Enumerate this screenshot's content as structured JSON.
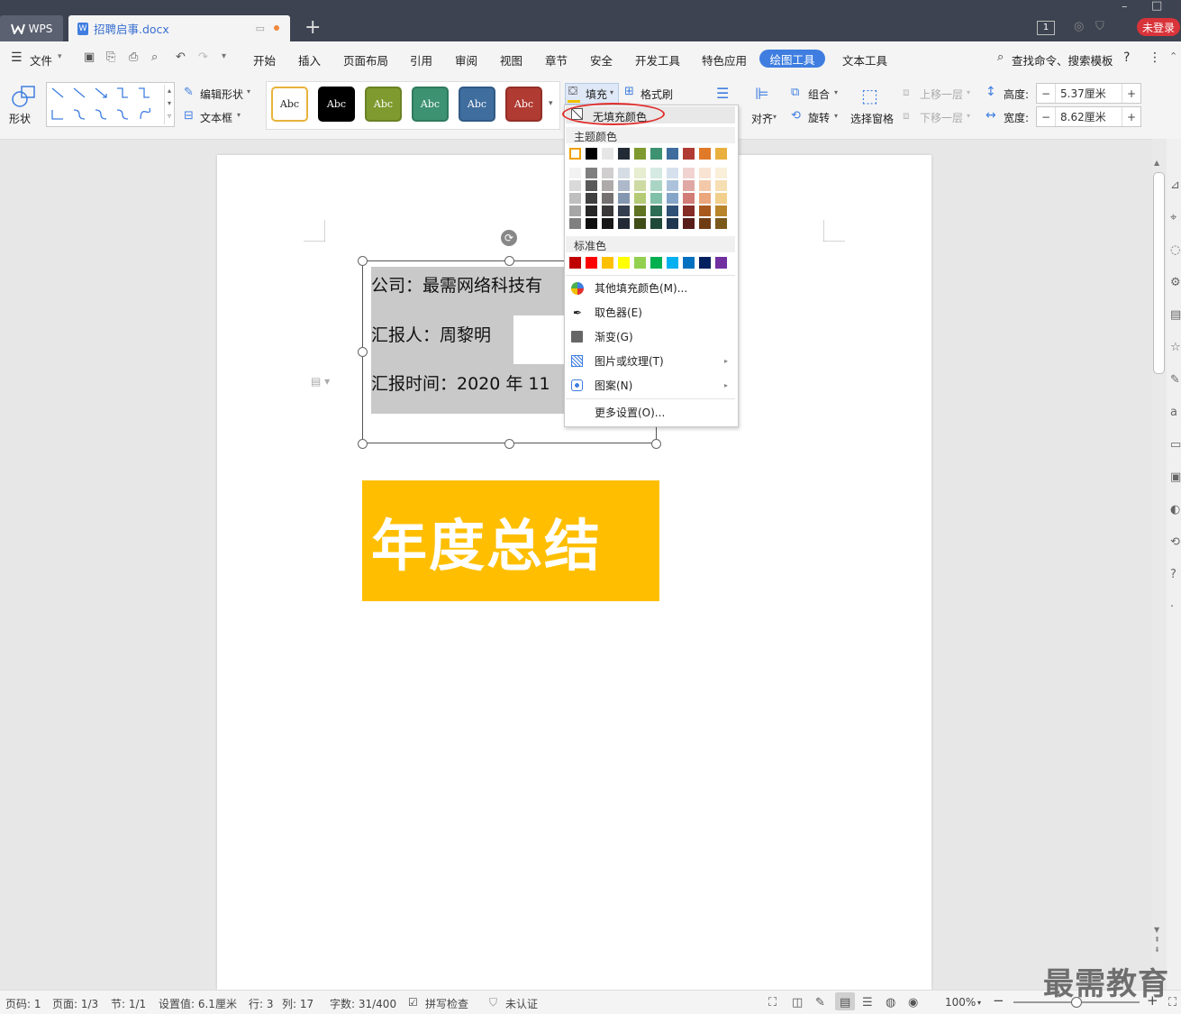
{
  "titlebar": {
    "app_tab": "WPS",
    "doc_tab": "招聘启事.docx",
    "login": "未登录",
    "badge": "1"
  },
  "menu": {
    "file": "文件",
    "items": [
      "开始",
      "插入",
      "页面布局",
      "引用",
      "审阅",
      "视图",
      "章节",
      "安全",
      "开发工具",
      "特色应用"
    ],
    "active": "绘图工具",
    "text_tools": "文本工具",
    "search": "查找命令、搜索模板"
  },
  "ribbon": {
    "shape": "形状",
    "edit_shape": "编辑形状",
    "text_box": "文本框",
    "style_samples": [
      {
        "label": "Abc",
        "bg": "#ffffff",
        "fg": "#222222",
        "border": "#e7b33b"
      },
      {
        "label": "Abc",
        "bg": "#000000",
        "fg": "#ffffff",
        "border": "#000000"
      },
      {
        "label": "Abc",
        "bg": "#7f9a2e",
        "fg": "#ffffff",
        "border": "#6a8224"
      },
      {
        "label": "Abc",
        "bg": "#3d9272",
        "fg": "#ffffff",
        "border": "#2f7a5e"
      },
      {
        "label": "Abc",
        "bg": "#3f6d9e",
        "fg": "#ffffff",
        "border": "#315a86"
      },
      {
        "label": "Abc",
        "bg": "#b03b32",
        "fg": "#ffffff",
        "border": "#932f27"
      }
    ],
    "fill": "填充",
    "format_painter": "格式刷",
    "align": "对齐",
    "group": "组合",
    "rotate": "旋转",
    "selection_pane": "选择窗格",
    "bring_forward": "上移一层",
    "send_backward": "下移一层",
    "height_label": "高度:",
    "height_value": "5.37厘米",
    "width_label": "宽度:",
    "width_value": "8.62厘米"
  },
  "dropdown": {
    "no_fill": "无填充颜色",
    "theme_colors": "主题颜色",
    "theme_row": [
      "#ffffff",
      "#000000",
      "#e7e6e6",
      "#222a35",
      "#7f9a2e",
      "#3d9272",
      "#3f6d9e",
      "#b03b32",
      "#e07a29",
      "#e9b040"
    ],
    "shade_cols": [
      [
        "#f2f2f2",
        "#d9d9d9",
        "#bfbfbf",
        "#a6a6a6",
        "#808080"
      ],
      [
        "#7f7f7f",
        "#595959",
        "#404040",
        "#262626",
        "#0d0d0d"
      ],
      [
        "#d0cece",
        "#aeaaaa",
        "#757171",
        "#3a3838",
        "#181717"
      ],
      [
        "#d6dce4",
        "#adb9ca",
        "#8497b0",
        "#333f4f",
        "#222a35"
      ],
      [
        "#e6edd1",
        "#cddba3",
        "#b4ca76",
        "#5f7322",
        "#3f4d17"
      ],
      [
        "#d5eae2",
        "#aad5c5",
        "#80c0a8",
        "#2e6d55",
        "#1e4939"
      ],
      [
        "#d6e1ed",
        "#adc3db",
        "#85a5c9",
        "#2f5176",
        "#1f364f"
      ],
      [
        "#f0d3d1",
        "#e0a8a4",
        "#d17c76",
        "#842c25",
        "#581d19"
      ],
      [
        "#f9e4d4",
        "#f3c9a9",
        "#eca67d",
        "#a85a1e",
        "#703c14"
      ],
      [
        "#faefd9",
        "#f6dfb3",
        "#f1cf8c",
        "#b9852a",
        "#7b591c"
      ]
    ],
    "standard_colors_label": "标准色",
    "standard_colors": [
      "#c00000",
      "#ff0000",
      "#ffc000",
      "#ffff00",
      "#92d050",
      "#00b050",
      "#00b0f0",
      "#0070c0",
      "#002060",
      "#7030a0"
    ],
    "more_fill": "其他填充颜色(M)...",
    "eyedropper": "取色器(E)",
    "gradient": "渐变(G)",
    "picture_texture": "图片或纹理(T)",
    "pattern": "图案(N)",
    "more_settings": "更多设置(O)..."
  },
  "document": {
    "line1": "公司：最需网络科技有",
    "line2": "汇报人：周黎明",
    "line3": "汇报时间：2020 年 11",
    "banner": "年度总结"
  },
  "status": {
    "page_num": "页码: 1",
    "pages": "页面: 1/3",
    "section": "节: 1/1",
    "setting": "设置值: 6.1厘米",
    "row": "行: 3",
    "col": "列: 17",
    "words": "字数: 31/400",
    "spell": "拼写检查",
    "cert": "未认证",
    "zoom": "100%",
    "zoom_level": 0.5
  },
  "watermark": "最需教育"
}
